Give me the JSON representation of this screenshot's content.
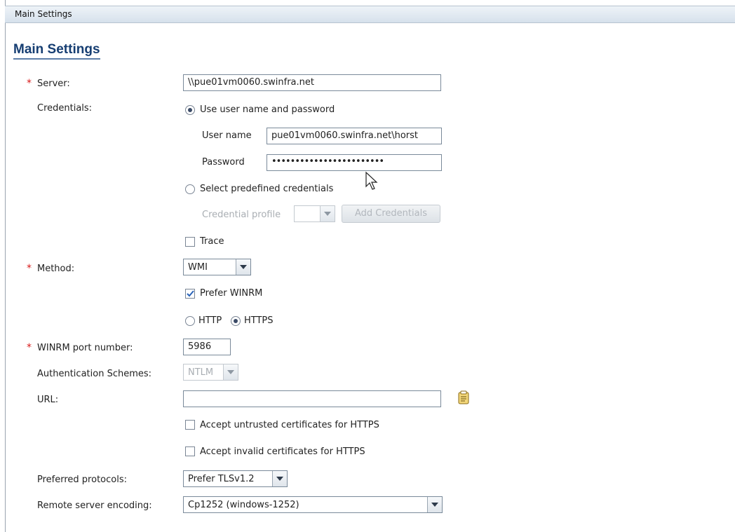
{
  "panel": {
    "title": "Main Settings"
  },
  "section": {
    "heading": "Main Settings"
  },
  "server": {
    "label": "Server:",
    "value": "\\\\pue01vm0060.swinfra.net",
    "required_marker": "*"
  },
  "credentials": {
    "label": "Credentials:",
    "option_user": "Use user name and password",
    "username_label": "User name",
    "username_value": "pue01vm0060.swinfra.net\\horst",
    "password_label": "Password",
    "password_value": "••••••••••••••••••••••••",
    "option_predefined": "Select predefined credentials",
    "profile_label": "Credential profile",
    "profile_value": "",
    "add_credentials_label": "Add Credentials",
    "selected_option": "Use user name and password"
  },
  "trace": {
    "label": "Trace",
    "checked": false
  },
  "method": {
    "label": "Method:",
    "value": "WMI",
    "required_marker": "*",
    "prefer_winrm_label": "Prefer WINRM",
    "prefer_winrm_checked": true,
    "http_label": "HTTP",
    "https_label": "HTTPS",
    "selected_protocol": "HTTPS"
  },
  "winrm_port": {
    "label": "WINRM port number:",
    "value": "5986",
    "required_marker": "*"
  },
  "auth_schemes": {
    "label": "Authentication Schemes:",
    "value": "NTLM"
  },
  "url": {
    "label": "URL:",
    "value": ""
  },
  "accept_untrusted": {
    "label": "Accept untrusted certificates for HTTPS",
    "checked": false
  },
  "accept_invalid": {
    "label": "Accept invalid certificates for HTTPS",
    "checked": false
  },
  "preferred_protocols": {
    "label": "Preferred protocols:",
    "value": "Prefer TLSv1.2"
  },
  "encoding": {
    "label": "Remote server encoding:",
    "value": "Cp1252 (windows-1252)"
  },
  "colors": {
    "heading": "#163e72",
    "required": "#d81a1a",
    "titlebar": "#dfe8f1"
  },
  "icons": {
    "url_helper": "clipboard-icon",
    "mouse": "cursor-arrow-icon"
  }
}
